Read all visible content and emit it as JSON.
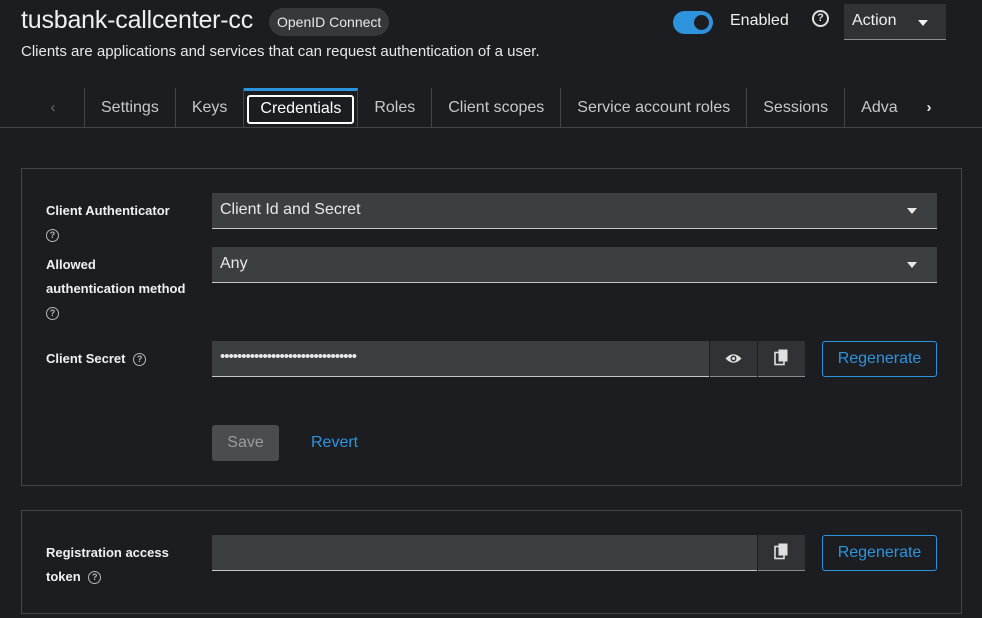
{
  "header": {
    "client_name": "tusbank-callcenter-cc",
    "protocol": "OpenID Connect",
    "enabled_label": "Enabled",
    "help_symbol": "?",
    "action_label": "Action",
    "subtitle": "Clients are applications and services that can request authentication of a user."
  },
  "tabs": {
    "prev_symbol": "‹",
    "next_symbol": "›",
    "items": [
      {
        "label": "Settings"
      },
      {
        "label": "Keys"
      },
      {
        "label": "Credentials"
      },
      {
        "label": "Roles"
      },
      {
        "label": "Client scopes"
      },
      {
        "label": "Service account roles"
      },
      {
        "label": "Sessions"
      },
      {
        "label": "Advanced"
      }
    ],
    "active_index": 2
  },
  "credentials": {
    "client_authenticator_label": "Client Authenticator",
    "client_authenticator_value": "Client Id and Secret",
    "allowed_method_label_1": "Allowed",
    "allowed_method_label_2": "authentication method",
    "allowed_method_value": "Any",
    "client_secret_label": "Client Secret",
    "client_secret_value": "••••••••••••••••••••••••••••••••",
    "regenerate_label": "Regenerate",
    "save_label": "Save",
    "revert_label": "Revert",
    "help_symbol": "?"
  },
  "registration": {
    "label_1": "Registration access",
    "label_2": "token",
    "regenerate_label": "Regenerate",
    "help_symbol": "?"
  },
  "colors": {
    "accent": "#2e93dd",
    "background": "#1b1d21",
    "input_bg": "#3c3f42"
  }
}
